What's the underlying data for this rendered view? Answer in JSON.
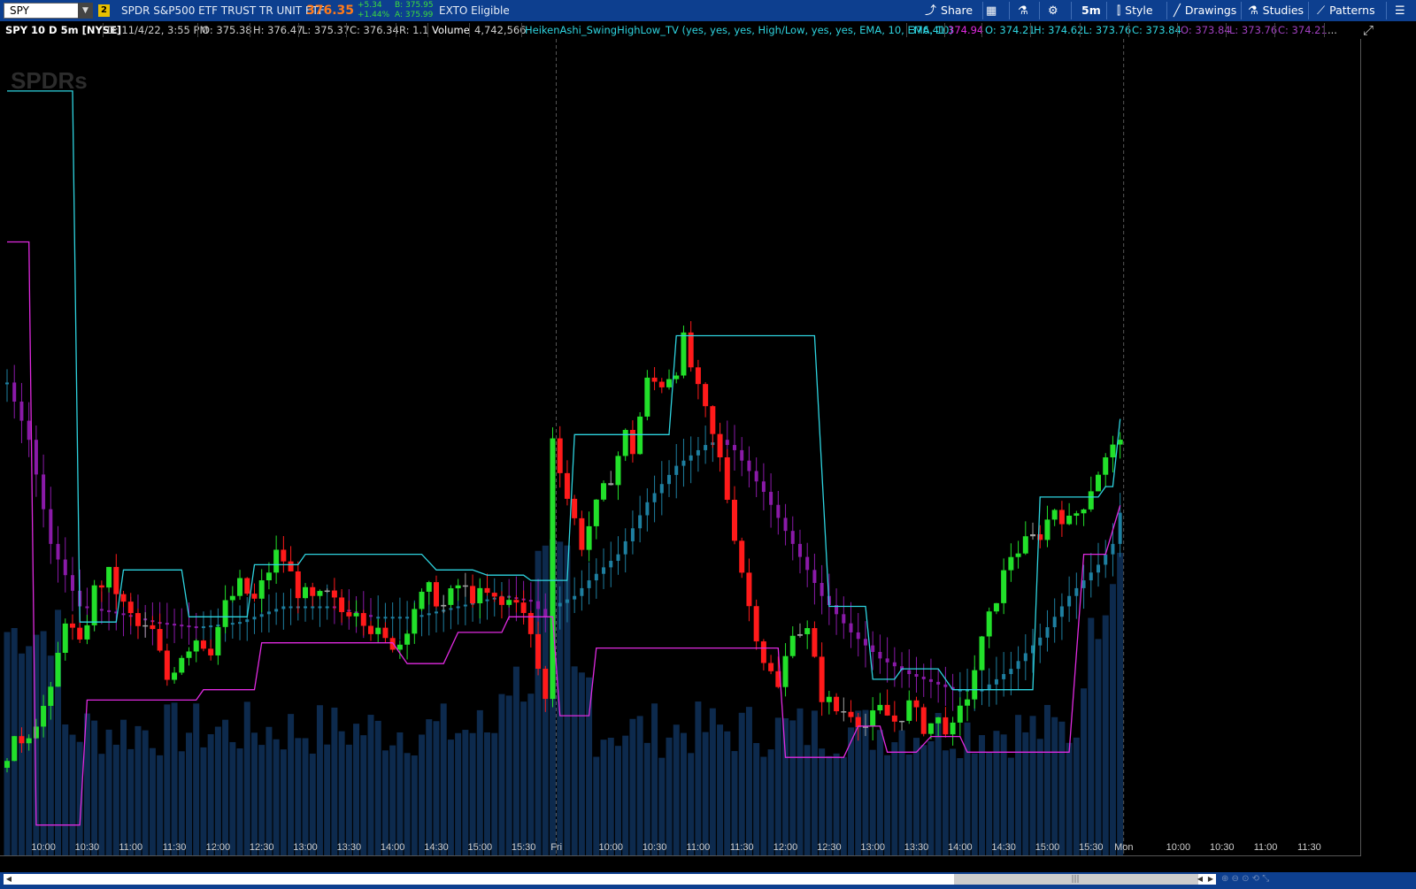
{
  "toolbar": {
    "symbol": "SPY",
    "link_number": "2",
    "description": "SPDR S&P500 ETF TRUST TR UNIT ETF",
    "last_price": "376.35",
    "change": "+5.34",
    "change_pct": "+1.44%",
    "bid": "B: 375.95",
    "ask": "A: 375.99",
    "exto": "EXTO Eligible",
    "buttons": {
      "share": "Share",
      "timeframe": "5m",
      "style": "Style",
      "drawings": "Drawings",
      "studies": "Studies",
      "patterns": "Patterns"
    }
  },
  "infobar": {
    "chart_label": "SPY 10 D 5m [NYSE]",
    "date": "D: 11/4/22, 3:55 PM",
    "open": "O: 375.38",
    "high": "H: 376.47",
    "low": "L: 375.37",
    "close": "C: 376.34",
    "range": "R: 1.1",
    "volume_label": "Volume",
    "volume_value": "4,742,566",
    "study": "HeikenAshi_SwingHighLow_TV (yes, yes, yes, High/Low, yes, yes, EMA, 10, EMA, 10)",
    "study_v1": "376.41",
    "study_v2": "374.94",
    "ha_open": "O: 374.21",
    "ha_high": "H: 374.62",
    "ha_low": "L: 373.76",
    "ha_close": "C: 373.84",
    "ha_open2": "O: 373.84",
    "ha_low2": "L: 373.76",
    "ha_close2": "C: 374.21",
    "more": "..."
  },
  "colors": {
    "background": "#000000",
    "toolbar": "#0d3f8f",
    "bull": "#22e02a",
    "bear": "#ff1a1a",
    "neutral": "#a0a0a0",
    "ha_teal": "#1e7fa0",
    "ha_purple": "#8a1aa8",
    "swing_high": "#2ed3df",
    "swing_low": "#e02ae0",
    "volume": "#0d2a4d",
    "price_label_green": "#22e02a",
    "price_label_magenta": "#e02ae0"
  },
  "watermark": "SPDRs",
  "chart_data": {
    "type": "candlestick",
    "interval": "5m",
    "ylim": [
      368.2,
      383.9
    ],
    "yticks": [
      369,
      370,
      371,
      372,
      373,
      374,
      375,
      376,
      377,
      378,
      379,
      380,
      381,
      382,
      383
    ],
    "x_labels": [
      "10:00",
      "10:30",
      "11:00",
      "11:30",
      "12:00",
      "12:30",
      "13:00",
      "13:30",
      "14:00",
      "14:30",
      "15:00",
      "15:30",
      "Fri",
      "10:00",
      "10:30",
      "11:00",
      "11:30",
      "12:00",
      "12:30",
      "13:00",
      "13:30",
      "14:00",
      "14:30",
      "15:00",
      "15:30",
      "Mon",
      "10:00",
      "10:30",
      "11:00",
      "11:30"
    ],
    "x_label_bars": [
      5,
      11,
      17,
      23,
      29,
      35,
      41,
      47,
      53,
      59,
      65,
      71,
      75.5,
      83,
      89,
      95,
      101,
      107,
      113,
      119,
      125,
      131,
      137,
      143,
      149,
      153.5,
      161,
      167,
      173,
      179
    ],
    "session_breaks": [
      75,
      153
    ],
    "bar_count": 154,
    "last_bar_labels": {
      "price": "376.34",
      "swing_low": "374.94"
    },
    "candle_keyframes": [
      [
        0,
        370.2
      ],
      [
        3,
        370.6
      ],
      [
        6,
        371.3
      ],
      [
        8,
        372.8
      ],
      [
        10,
        372.2
      ],
      [
        12,
        373.3
      ],
      [
        14,
        373.6
      ],
      [
        16,
        373.0
      ],
      [
        18,
        372.6
      ],
      [
        20,
        372.5
      ],
      [
        22,
        371.6
      ],
      [
        24,
        372.1
      ],
      [
        26,
        372.4
      ],
      [
        28,
        372.2
      ],
      [
        30,
        373.0
      ],
      [
        32,
        373.4
      ],
      [
        34,
        373.1
      ],
      [
        36,
        373.7
      ],
      [
        37,
        374.0
      ],
      [
        38,
        373.9
      ],
      [
        40,
        373.3
      ],
      [
        42,
        373.1
      ],
      [
        44,
        373.2
      ],
      [
        46,
        372.9
      ],
      [
        48,
        373.0
      ],
      [
        50,
        372.6
      ],
      [
        52,
        372.3
      ],
      [
        54,
        372.3
      ],
      [
        56,
        373.0
      ],
      [
        58,
        373.3
      ],
      [
        60,
        373.0
      ],
      [
        62,
        373.4
      ],
      [
        64,
        373.2
      ],
      [
        66,
        373.2
      ],
      [
        68,
        373.0
      ],
      [
        70,
        373.2
      ],
      [
        72,
        372.4
      ],
      [
        74,
        371.2
      ],
      [
        75,
        376.3
      ],
      [
        77,
        375.1
      ],
      [
        79,
        374.2
      ],
      [
        81,
        374.9
      ],
      [
        83,
        375.5
      ],
      [
        85,
        376.3
      ],
      [
        86,
        376.0
      ],
      [
        88,
        377.3
      ],
      [
        90,
        377.3
      ],
      [
        92,
        377.6
      ],
      [
        93,
        378.1
      ],
      [
        95,
        377.1
      ],
      [
        96,
        376.7
      ],
      [
        98,
        375.8
      ],
      [
        100,
        374.4
      ],
      [
        102,
        373.0
      ],
      [
        104,
        372.0
      ],
      [
        106,
        371.4
      ],
      [
        108,
        372.6
      ],
      [
        110,
        372.5
      ],
      [
        112,
        371.3
      ],
      [
        114,
        371.0
      ],
      [
        116,
        371.0
      ],
      [
        118,
        370.7
      ],
      [
        120,
        371.0
      ],
      [
        122,
        370.8
      ],
      [
        124,
        371.1
      ],
      [
        126,
        370.7
      ],
      [
        128,
        370.8
      ],
      [
        130,
        370.6
      ],
      [
        132,
        371.3
      ],
      [
        134,
        372.3
      ],
      [
        136,
        373.2
      ],
      [
        138,
        374.0
      ],
      [
        140,
        374.2
      ],
      [
        142,
        374.4
      ],
      [
        144,
        374.9
      ],
      [
        146,
        374.6
      ],
      [
        148,
        375.0
      ],
      [
        150,
        375.6
      ],
      [
        152,
        376.0
      ],
      [
        153,
        376.34
      ]
    ],
    "ha_keyframes": [
      [
        0,
        377.3
      ],
      [
        3,
        376.2
      ],
      [
        6,
        374.2
      ],
      [
        8,
        373.6
      ],
      [
        10,
        373.0
      ],
      [
        14,
        372.9
      ],
      [
        20,
        372.7
      ],
      [
        26,
        372.6
      ],
      [
        32,
        372.7
      ],
      [
        38,
        373.0
      ],
      [
        44,
        373.0
      ],
      [
        50,
        372.8
      ],
      [
        56,
        372.8
      ],
      [
        62,
        373.0
      ],
      [
        68,
        373.2
      ],
      [
        72,
        373.1
      ],
      [
        74,
        372.8
      ],
      [
        75,
        373.0
      ],
      [
        78,
        373.2
      ],
      [
        80,
        373.5
      ],
      [
        84,
        374.0
      ],
      [
        88,
        375.0
      ],
      [
        92,
        375.7
      ],
      [
        96,
        376.1
      ],
      [
        98,
        376.2
      ],
      [
        100,
        376.0
      ],
      [
        104,
        375.2
      ],
      [
        108,
        374.2
      ],
      [
        112,
        373.2
      ],
      [
        116,
        372.5
      ],
      [
        120,
        372.0
      ],
      [
        124,
        371.7
      ],
      [
        128,
        371.5
      ],
      [
        130,
        371.4
      ],
      [
        134,
        371.4
      ],
      [
        138,
        371.8
      ],
      [
        142,
        372.4
      ],
      [
        146,
        373.2
      ],
      [
        150,
        373.8
      ],
      [
        152,
        374.2
      ],
      [
        153,
        374.8
      ]
    ],
    "swing_high": [
      [
        0,
        382.9
      ],
      [
        9,
        382.9
      ],
      [
        10,
        372.7
      ],
      [
        15,
        372.7
      ],
      [
        16,
        373.7
      ],
      [
        24,
        373.7
      ],
      [
        25,
        372.8
      ],
      [
        33,
        372.8
      ],
      [
        34,
        373.8
      ],
      [
        40,
        373.8
      ],
      [
        41,
        374.0
      ],
      [
        57,
        374.0
      ],
      [
        59,
        373.7
      ],
      [
        64,
        373.7
      ],
      [
        66,
        373.6
      ],
      [
        71,
        373.6
      ],
      [
        72,
        373.5
      ],
      [
        77,
        373.5
      ],
      [
        78,
        376.3
      ],
      [
        91,
        376.3
      ],
      [
        92,
        378.2
      ],
      [
        111,
        378.2
      ],
      [
        113,
        373.0
      ],
      [
        118,
        373.0
      ],
      [
        119,
        371.6
      ],
      [
        122,
        371.6
      ],
      [
        123,
        371.8
      ],
      [
        128,
        371.8
      ],
      [
        130,
        371.4
      ],
      [
        141,
        371.4
      ],
      [
        142,
        375.1
      ],
      [
        150,
        375.1
      ],
      [
        151,
        375.3
      ],
      [
        152,
        375.3
      ],
      [
        153,
        376.6
      ]
    ],
    "swing_low": [
      [
        0,
        380.0
      ],
      [
        3,
        380.0
      ],
      [
        4,
        368.8
      ],
      [
        10,
        368.8
      ],
      [
        11,
        371.2
      ],
      [
        26,
        371.2
      ],
      [
        27,
        371.4
      ],
      [
        34,
        371.4
      ],
      [
        35,
        372.3
      ],
      [
        53,
        372.3
      ],
      [
        55,
        371.9
      ],
      [
        60,
        371.9
      ],
      [
        62,
        372.5
      ],
      [
        68,
        372.5
      ],
      [
        69,
        372.8
      ],
      [
        75,
        372.8
      ],
      [
        76,
        370.9
      ],
      [
        80,
        370.9
      ],
      [
        81,
        372.2
      ],
      [
        106,
        372.2
      ],
      [
        107,
        370.1
      ],
      [
        115,
        370.1
      ],
      [
        117,
        370.7
      ],
      [
        120,
        370.7
      ],
      [
        121,
        370.2
      ],
      [
        125,
        370.2
      ],
      [
        127,
        370.5
      ],
      [
        131,
        370.5
      ],
      [
        132,
        370.2
      ],
      [
        146,
        370.2
      ],
      [
        148,
        374.0
      ],
      [
        151,
        374.0
      ],
      [
        153,
        374.94
      ]
    ],
    "volume_scale_note": "relative"
  }
}
